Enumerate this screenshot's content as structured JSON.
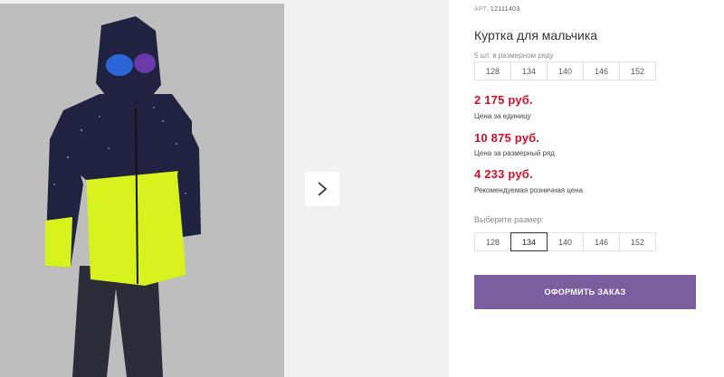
{
  "product": {
    "art_label": "АРТ.",
    "art_number": "12111403",
    "title": "Куртка для мальчика",
    "pack_caption": "5 шт. в размерном ряду",
    "pack_sizes": [
      "128",
      "134",
      "140",
      "146",
      "152"
    ],
    "prices": [
      {
        "value": "2 175 руб.",
        "label": "Цена за единицу"
      },
      {
        "value": "10 875 руб.",
        "label": "Цена за размерный ряд"
      },
      {
        "value": "4 233 руб.",
        "label": "Рекомендуемая розничная цена"
      }
    ],
    "choose_size_label": "Выберите размер:",
    "choose_sizes": [
      "128",
      "134",
      "140",
      "146",
      "152"
    ],
    "selected_size": "134",
    "order_button": "ОФОРМИТЬ ЗАКАЗ"
  },
  "gallery": {
    "next_icon": "chevron-right-icon"
  },
  "colors": {
    "price": "#d0102a",
    "order_button": "#7a5ea0",
    "jacket_dark": "#1f2340",
    "jacket_lime": "#d8f21e"
  }
}
